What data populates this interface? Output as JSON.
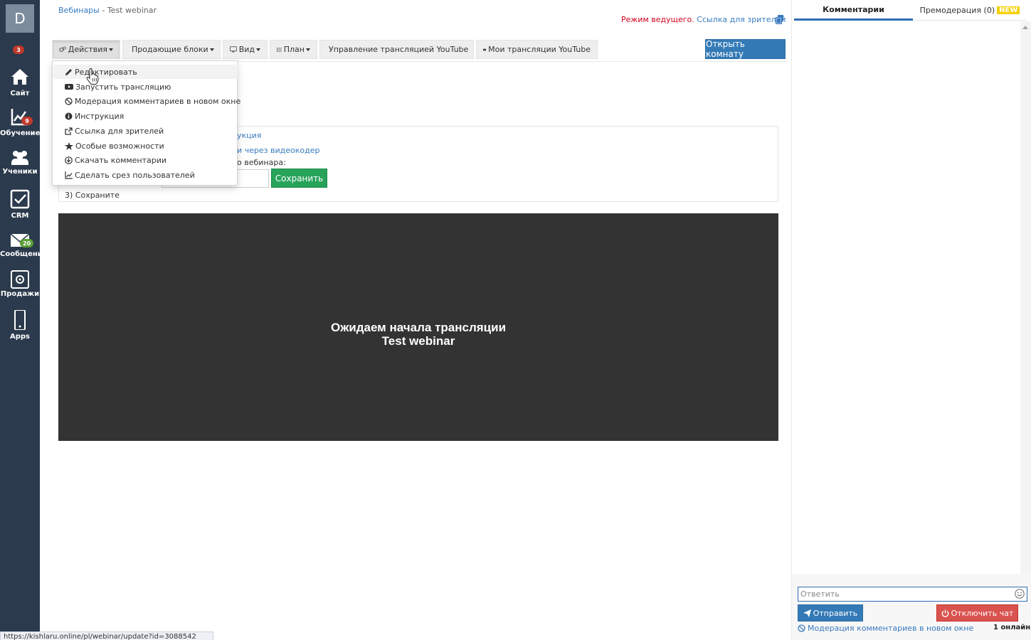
{
  "sidebar": {
    "avatar_letter": "D",
    "top_badge": "3",
    "items": [
      {
        "label": "Сайт",
        "badge": ""
      },
      {
        "label": "Обучение",
        "badge": "9"
      },
      {
        "label": "Ученики",
        "badge": ""
      },
      {
        "label": "CRM",
        "badge": ""
      },
      {
        "label": "Сообщения",
        "badge": "20"
      },
      {
        "label": "Продажи",
        "badge": ""
      },
      {
        "label": "Apps",
        "badge": ""
      }
    ]
  },
  "breadcrumb": {
    "parent": "Вебинары",
    "separator": " - ",
    "current": "Test webinar"
  },
  "host": {
    "mode_text": "Режим ведущего.",
    "viewer_link": "Ссылка для зрителей"
  },
  "toolbar": {
    "actions": "Действия",
    "selling_blocks": "Продающие блоки",
    "view": "Вид",
    "plan": "План",
    "youtube_manage": "Управление трансляцией YouTube",
    "youtube_my": "Мои трансляции YouTube",
    "open_room": "Открыть комнату"
  },
  "actions_menu": {
    "items": [
      {
        "label": "Редактировать",
        "icon": "pencil-icon"
      },
      {
        "label": "Запустить трансляцию",
        "icon": "youtube-icon"
      },
      {
        "label": "Модерация комментариев в новом окне",
        "icon": "ban-icon"
      },
      {
        "label": "Инструкция",
        "icon": "info-icon"
      },
      {
        "label": "Ссылка для зрителей",
        "icon": "external-link-icon"
      },
      {
        "label": "Особые возможности",
        "icon": "star-icon"
      },
      {
        "label": "Скачать комментарии",
        "icon": "download-icon"
      },
      {
        "label": "Сделать срез пользователей",
        "icon": "chart-icon"
      }
    ]
  },
  "instructions": {
    "link1": "укция",
    "link2": "и через видеокодер",
    "text3": "о вебинара:",
    "save_label": "Сохранить",
    "step3": "3) Сохраните"
  },
  "video": {
    "waiting_text": "Ожидаем начала трансляции",
    "title": "Test webinar"
  },
  "status_url": "https://kishlaru.online/pl/webinar/update?id=3088542",
  "chat": {
    "tab_comments": "Комментарии",
    "tab_premod": "Премодерация (0)",
    "new_badge": "NEW",
    "reply_placeholder": "Ответить",
    "send_label": "Отправить",
    "chat_off_label": "Отключить чат",
    "moderation_link": "Модерация комментариев в новом окне",
    "online": "1 онлайн"
  }
}
